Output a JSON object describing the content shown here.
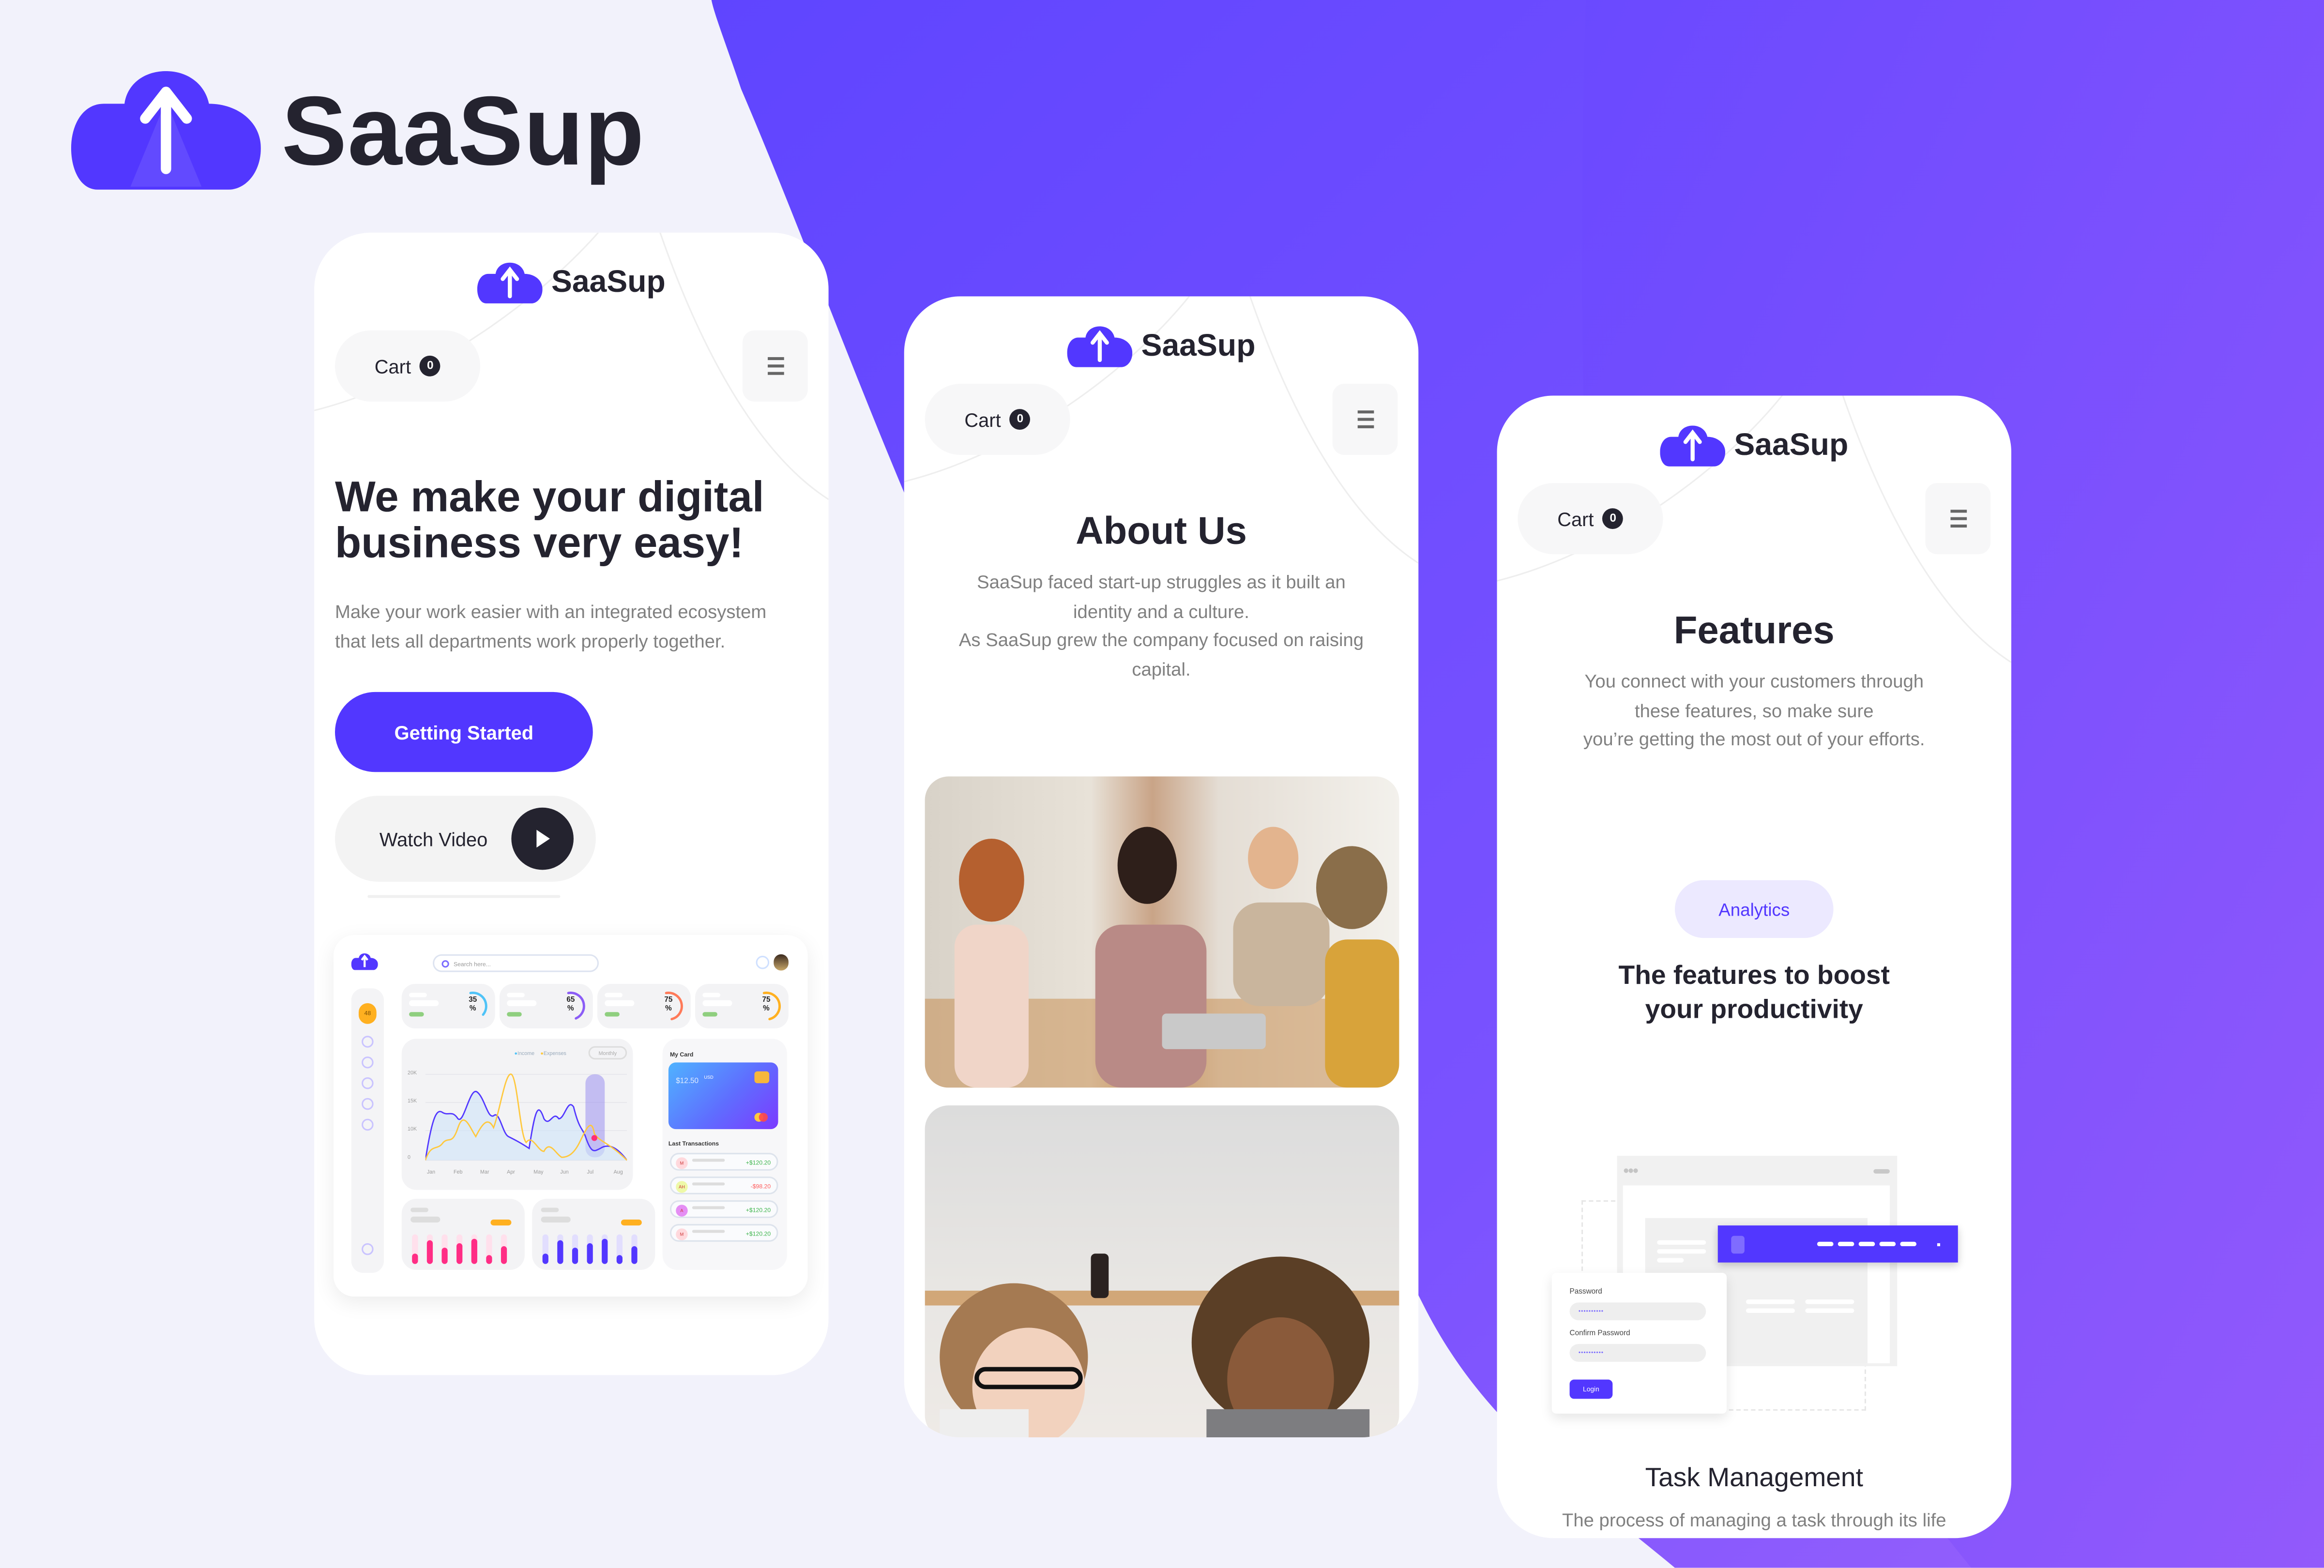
{
  "brand": {
    "name": "SaaSup",
    "primary_color": "#5237ff",
    "dark_text_color": "#24232f",
    "muted_text_color": "#808080",
    "background_color": "#f2f2fb",
    "gradient_purple": [
      "#5f45ff",
      "#8b5cf6"
    ]
  },
  "header_logo": {
    "text": "SaaSup",
    "icon": "cloud-upload-icon"
  },
  "phones": [
    {
      "screen": "home",
      "logo_text": "SaaSup",
      "cart_label": "Cart",
      "cart_count": "0",
      "menu_icon": "hamburger-menu-icon",
      "hero_title_line1": "We make your digital",
      "hero_title_line2": "business very easy!",
      "hero_subtitle_line1": "Make your work easier with an integrated ecosystem",
      "hero_subtitle_line2": "that lets all departments work properly together.",
      "primary_button": "Getting Started",
      "secondary_button": "Watch Video",
      "dashboard_preview": {
        "search_placeholder": "Search here...",
        "sidebar_badge": "48",
        "stats": [
          {
            "value": "35",
            "unit": "%",
            "color": "#4fc3f7",
            "progress": 0.35
          },
          {
            "value": "65",
            "unit": "%",
            "color": "#8b5cf6",
            "progress": 0.65
          },
          {
            "value": "75",
            "unit": "%",
            "color": "#ff7a59",
            "progress": 0.75
          },
          {
            "value": "75",
            "unit": "%",
            "color": "#ffb020",
            "progress": 0.75
          }
        ],
        "chart": {
          "legend": [
            "Income",
            "Expenses"
          ],
          "period_select": "Monthly",
          "y_ticks": [
            "20K",
            "15K",
            "10K",
            "0"
          ],
          "x_ticks": [
            "Jan",
            "Feb",
            "Mar",
            "Apr",
            "May",
            "Jun",
            "Jul",
            "Aug"
          ]
        },
        "card": {
          "title": "My Card",
          "balance": "$12.50",
          "currency": "USD"
        },
        "transactions": {
          "title": "Last Transactions",
          "items": [
            {
              "initials": "M",
              "amount": "+$120.20",
              "positive": true
            },
            {
              "initials": "AH",
              "amount": "-$98.20",
              "positive": false
            },
            {
              "initials": "A",
              "amount": "+$120.20",
              "positive": true
            },
            {
              "initials": "M",
              "amount": "+$120.20",
              "positive": true
            }
          ]
        }
      }
    },
    {
      "screen": "about",
      "logo_text": "SaaSup",
      "cart_label": "Cart",
      "cart_count": "0",
      "title": "About Us",
      "text_line1": "SaaSup faced start-up struggles as it built an",
      "text_line2": "identity and a culture.",
      "text_line3": "As SaaSup grew  the company focused on raising",
      "text_line4": "capital.",
      "images": [
        "team-meeting-photo",
        "two-women-working-photo"
      ]
    },
    {
      "screen": "features",
      "logo_text": "SaaSup",
      "cart_label": "Cart",
      "cart_count": "0",
      "title": "Features",
      "text_line1": "You connect with your customers through",
      "text_line2": "these  features, so make sure",
      "text_line3": "you’re getting the most out of your efforts.",
      "tag": "Analytics",
      "subtitle_line1": "The features to boost",
      "subtitle_line2": "your productivity",
      "illustration": {
        "password_label": "Password",
        "confirm_label": "Confirm Password",
        "password_mask": "••••••••••",
        "login_button": "Login"
      },
      "feature_title": "Task Management",
      "feature_text": "The process of managing a task through its life"
    }
  ]
}
